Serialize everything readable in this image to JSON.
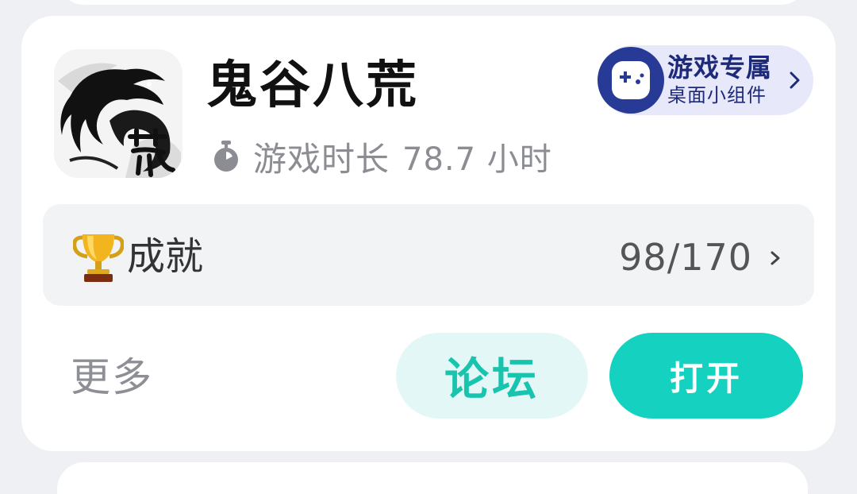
{
  "game": {
    "title": "鬼谷八荒",
    "icon": "ink-dragon-game-icon",
    "playtime_label": "游戏时长",
    "playtime_value": "78.7 小时"
  },
  "widget_promo": {
    "title": "游戏专属",
    "subtitle": "桌面小组件",
    "icon": "gamepad-icon",
    "bg_color": "#e8e8fb",
    "accent_color": "#263a96"
  },
  "achievements": {
    "label": "成就",
    "count": "98/170",
    "icon": "trophy-icon"
  },
  "actions": {
    "more_label": "更多",
    "forum_label": "论坛",
    "open_label": "打开"
  },
  "colors": {
    "primary": "#14d2bf",
    "primary_soft": "#e3f8f6",
    "card_bg": "#ffffff",
    "page_bg": "#eef0f3"
  }
}
